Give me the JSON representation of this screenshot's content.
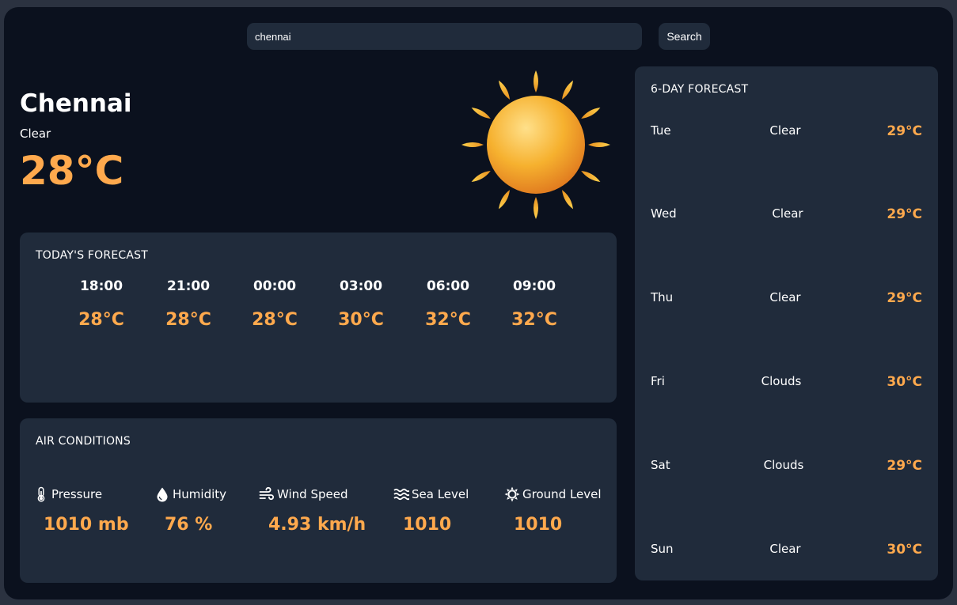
{
  "search": {
    "value": "chennai",
    "button_label": "Search"
  },
  "current": {
    "city": "Chennai",
    "condition": "Clear",
    "temp": "28°C",
    "icon": "sun-icon"
  },
  "today": {
    "title": "TODAY'S FORECAST",
    "hours": [
      {
        "time": "18:00",
        "temp": "28°C"
      },
      {
        "time": "21:00",
        "temp": "28°C"
      },
      {
        "time": "00:00",
        "temp": "28°C"
      },
      {
        "time": "03:00",
        "temp": "30°C"
      },
      {
        "time": "06:00",
        "temp": "32°C"
      },
      {
        "time": "09:00",
        "temp": "32°C"
      }
    ]
  },
  "air": {
    "title": "AIR CONDITIONS",
    "items": [
      {
        "label": "Pressure",
        "value": "1010 mb",
        "icon": "thermometer-icon"
      },
      {
        "label": "Humidity",
        "value": "76 %",
        "icon": "water-drop-icon"
      },
      {
        "label": "Wind Speed",
        "value": "4.93 km/h",
        "icon": "wind-icon"
      },
      {
        "label": "Sea Level",
        "value": "1010",
        "icon": "waves-icon"
      },
      {
        "label": "Ground Level",
        "value": "1010",
        "icon": "sun-gear-icon"
      }
    ]
  },
  "week": {
    "title": "6-DAY FORECAST",
    "days": [
      {
        "day": "Tue",
        "condition": "Clear",
        "temp": "29°C"
      },
      {
        "day": "Wed",
        "condition": "Clear",
        "temp": "29°C"
      },
      {
        "day": "Thu",
        "condition": "Clear",
        "temp": "29°C"
      },
      {
        "day": "Fri",
        "condition": "Clouds",
        "temp": "30°C"
      },
      {
        "day": "Sat",
        "condition": "Clouds",
        "temp": "29°C"
      },
      {
        "day": "Sun",
        "condition": "Clear",
        "temp": "30°C"
      }
    ]
  },
  "colors": {
    "accent": "#ffa94d",
    "panel": "#202b3b",
    "background": "#0b111e"
  }
}
